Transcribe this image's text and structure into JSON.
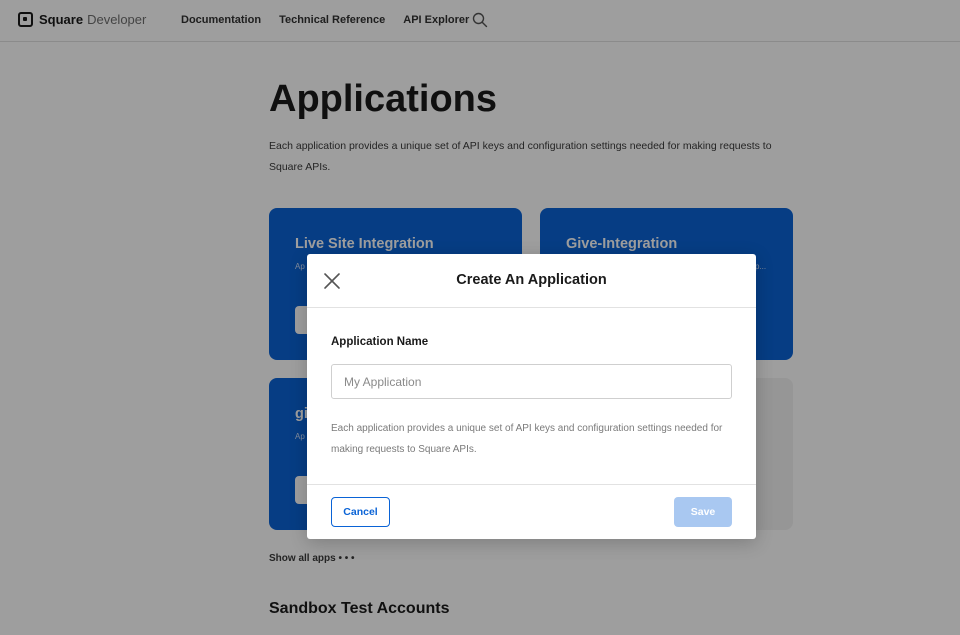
{
  "nav": {
    "brand_square": "Square",
    "brand_developer": "Developer",
    "links": [
      "Documentation",
      "Technical Reference",
      "API Explorer"
    ],
    "search_icon": "search-icon"
  },
  "main": {
    "title": "Applications",
    "description": "Each application provides a unique set of API keys and configuration settings needed for making requests to Square APIs.",
    "cards": [
      {
        "name": "Live Site Integration",
        "sub": "Ap"
      },
      {
        "name": "Give-Integration",
        "sub": "p..."
      },
      {
        "name": "gi",
        "sub": "Ap"
      }
    ],
    "show_all": "Show all apps • • •",
    "sandbox_heading": "Sandbox Test Accounts"
  },
  "modal": {
    "title": "Create An Application",
    "close_icon": "close-icon",
    "field_label": "Application Name",
    "field_placeholder": "My Application",
    "field_value": "",
    "help_text": "Each application provides a unique set of API keys and configuration settings needed for making requests to Square APIs.",
    "cancel_label": "Cancel",
    "save_label": "Save"
  },
  "colors": {
    "accent": "#0a63d6",
    "save_disabled": "#a9c8f1",
    "overlay": "rgba(0,0,0,0.38)"
  }
}
